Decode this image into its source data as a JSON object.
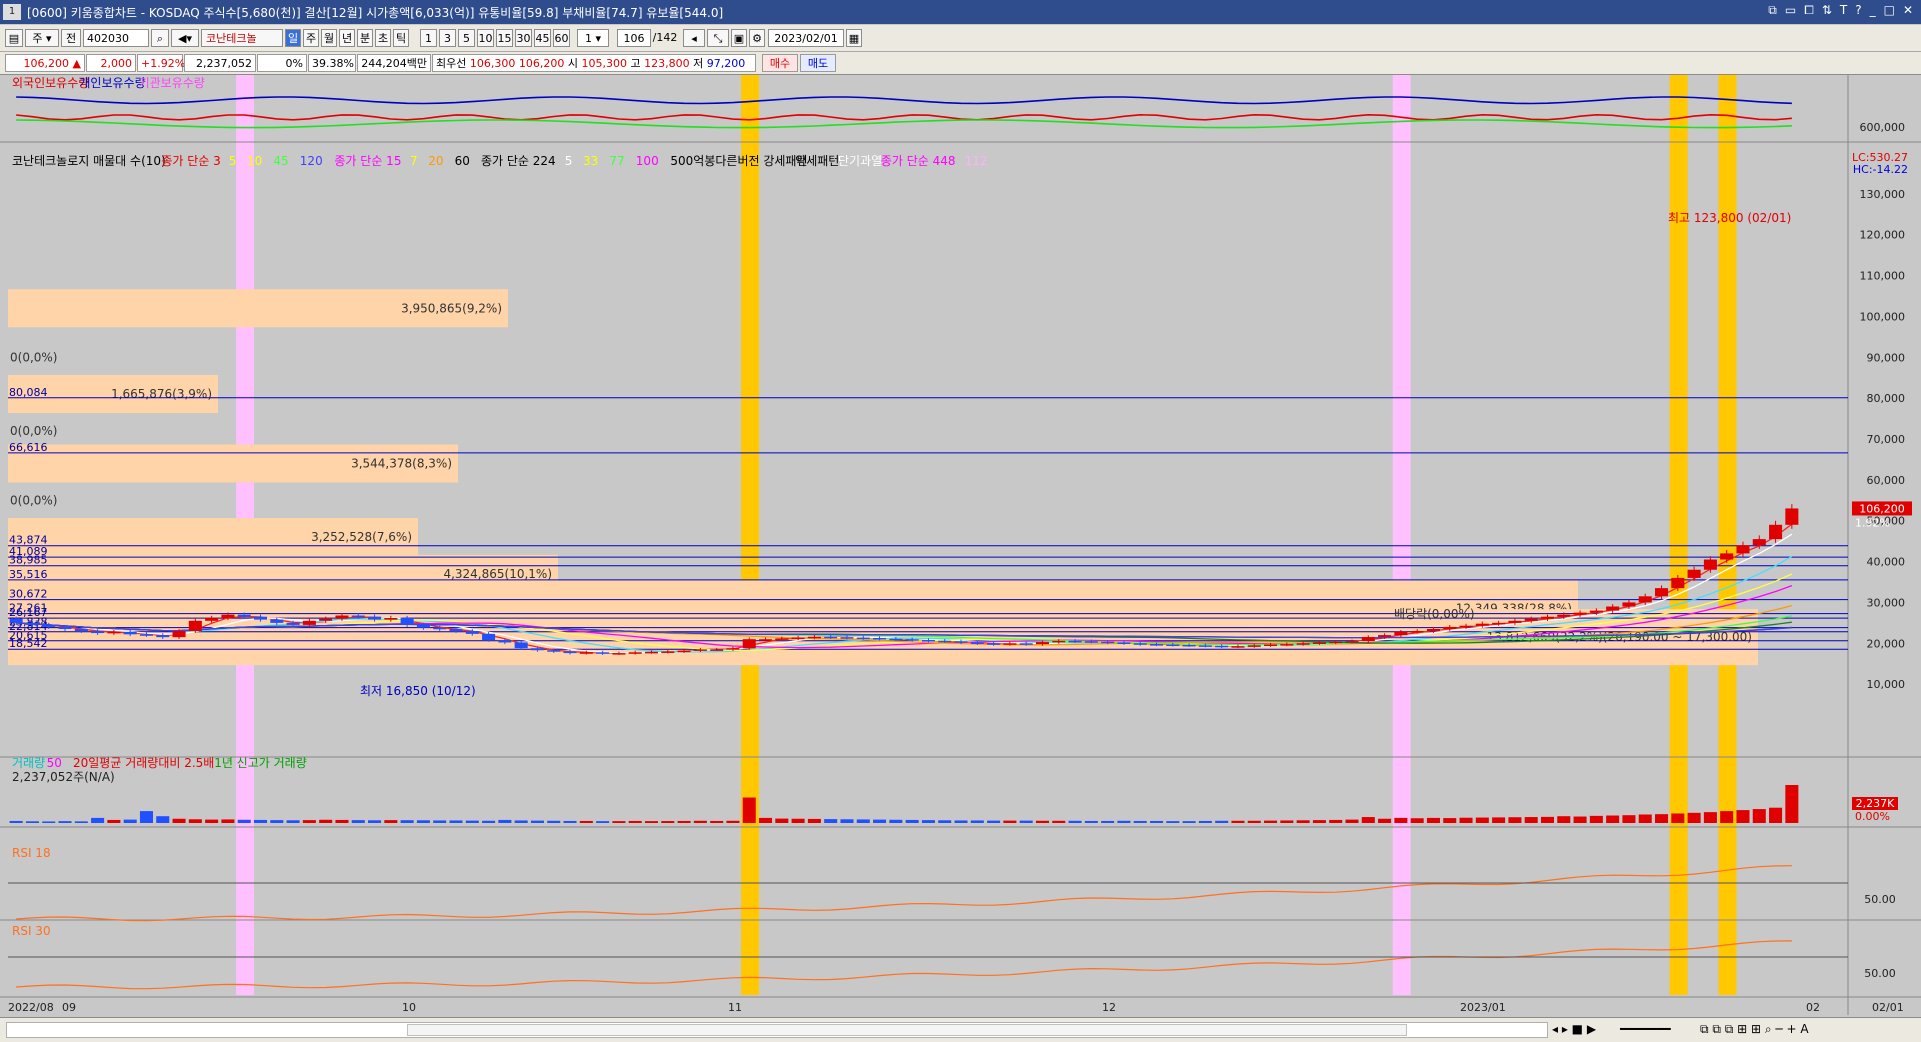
{
  "window": {
    "title": "[0600] 키움종합차트 - KOSDAQ 주식수[5,680(천)] 결산[12월] 시가총액[6,033(억)] 유통비율[59.8] 부채비율[74.7] 유보율[544.0]",
    "number": "1"
  },
  "toolbar": {
    "type_sel": "주",
    "prefix": "전",
    "code": "402030",
    "name": "코난테크놀",
    "periods": [
      "일",
      "주",
      "월",
      "년",
      "분",
      "초",
      "틱"
    ],
    "minutes": [
      "1",
      "3",
      "5",
      "10",
      "15",
      "30",
      "45",
      "60"
    ],
    "count_sel": "1",
    "page": "106",
    "page_total": "/142",
    "date": "2023/02/01"
  },
  "info": {
    "price": "106,200",
    "change": "2,000",
    "change_pct": "+1.92%",
    "volume": "2,237,052",
    "ratio": "0%",
    "ratio2": "39.38%",
    "amount": "244,204백만",
    "best_label": "최우선",
    "best_ask": "106,300",
    "best_bid": "106,200",
    "open_label": "시",
    "open": "105,300",
    "high_label": "고",
    "high": "123,800",
    "low_label": "저",
    "low": "97,200",
    "buy_btn": "매수",
    "sell_btn": "매도"
  },
  "legend": {
    "top": [
      {
        "text": "외국인보유수량",
        "color": "#e00000"
      },
      {
        "text": "개인보유수량",
        "color": "#0000c0"
      },
      {
        "text": "기관보유수량",
        "color": "#ff40ff"
      }
    ],
    "price": [
      {
        "text": "코난테크놀로지 매물대 수(10)",
        "color": "#000000"
      },
      {
        "text": "종가 단순 3",
        "color": "#e00000"
      },
      {
        "text": "5",
        "color": "#ffff00"
      },
      {
        "text": "10",
        "color": "#ffff00"
      },
      {
        "text": "45",
        "color": "#40ff40"
      },
      {
        "text": "120",
        "color": "#4040ff"
      },
      {
        "text": "종가 단순 15",
        "color": "#ff00ff"
      },
      {
        "text": "7",
        "color": "#ffff00"
      },
      {
        "text": "20",
        "color": "#ff9900"
      },
      {
        "text": "60",
        "color": "#000000"
      },
      {
        "text": "종가 단순 224",
        "color": "#000000"
      },
      {
        "text": "5",
        "color": "#ffffff"
      },
      {
        "text": "33",
        "color": "#ffff00"
      },
      {
        "text": "77",
        "color": "#40ff40"
      },
      {
        "text": "100",
        "color": "#ff00ff"
      },
      {
        "text": "500억봉다른버전 강세패턴",
        "color": "#000000"
      },
      {
        "text": "약세패턴",
        "color": "#000000"
      },
      {
        "text": "단기과열",
        "color": "#ffffff"
      },
      {
        "text": "종가 단순 448",
        "color": "#ff00ff"
      },
      {
        "text": "112",
        "color": "#ffb0ff"
      }
    ],
    "volume": [
      {
        "text": "거래량",
        "color": "#00c0c0"
      },
      {
        "text": "50",
        "color": "#ff00ff"
      },
      {
        "text": "20일평균 거래량대비 2.5배",
        "color": "#e00000"
      },
      {
        "text": "1년 신고가 거래량",
        "color": "#00a000"
      }
    ],
    "volume_value": "2,237,052주(N/A)",
    "rsi18": "RSI 18",
    "rsi30": "RSI 30"
  },
  "chart_data": {
    "type": "candlestick",
    "dates": [
      "2022/08/22",
      "2022/08/23",
      "2022/08/24",
      "2022/08/25",
      "2022/08/26",
      "2022/08/29",
      "2022/08/30",
      "2022/08/31",
      "2022/09/01",
      "2022/09/02",
      "2022/09/05",
      "2022/09/06",
      "2022/09/07",
      "2022/09/08",
      "2022/09/13",
      "2022/09/14",
      "2022/09/15",
      "2022/09/16",
      "2022/09/19",
      "2022/09/20",
      "2022/09/21",
      "2022/09/22",
      "2022/09/23",
      "2022/09/26",
      "2022/09/27",
      "2022/09/28",
      "2022/09/29",
      "2022/09/30",
      "2022/10/04",
      "2022/10/05",
      "2022/10/06",
      "2022/10/07",
      "2022/10/11",
      "2022/10/12",
      "2022/10/13",
      "2022/10/14",
      "2022/10/17",
      "2022/10/18",
      "2022/10/19",
      "2022/10/20",
      "2022/10/21",
      "2022/10/24",
      "2022/10/25",
      "2022/10/26",
      "2022/10/27",
      "2022/10/28",
      "2022/10/31",
      "2022/11/01",
      "2022/11/02",
      "2022/11/03",
      "2022/11/04",
      "2022/11/07",
      "2022/11/08",
      "2022/11/09",
      "2022/11/10",
      "2022/11/11",
      "2022/11/14",
      "2022/11/15",
      "2022/11/16",
      "2022/11/17",
      "2022/11/18",
      "2022/11/21",
      "2022/11/22",
      "2022/11/23",
      "2022/11/24",
      "2022/11/25",
      "2022/11/28",
      "2022/11/29",
      "2022/11/30",
      "2022/12/01",
      "2022/12/02",
      "2022/12/05",
      "2022/12/06",
      "2022/12/07",
      "2022/12/08",
      "2022/12/09",
      "2022/12/12",
      "2022/12/13",
      "2022/12/14",
      "2022/12/15",
      "2022/12/16",
      "2022/12/19",
      "2022/12/20",
      "2022/12/21",
      "2022/12/22",
      "2022/12/23",
      "2022/12/26",
      "2022/12/27",
      "2022/12/28",
      "2023/01/02",
      "2023/01/03",
      "2023/01/04",
      "2023/01/05",
      "2023/01/06",
      "2023/01/09",
      "2023/01/10",
      "2023/01/11",
      "2023/01/12",
      "2023/01/13",
      "2023/01/16",
      "2023/01/17",
      "2023/01/18",
      "2023/01/19",
      "2023/01/20",
      "2023/01/25",
      "2023/01/26",
      "2023/01/27",
      "2023/01/30",
      "2023/01/31",
      "2023/02/01"
    ],
    "open": [
      26000,
      25000,
      24500,
      24000,
      23500,
      23000,
      22500,
      22800,
      22200,
      22000,
      21500,
      23000,
      25500,
      26200,
      27000,
      26500,
      25800,
      25000,
      24500,
      25500,
      26000,
      26800,
      26500,
      25800,
      26200,
      24500,
      23800,
      23500,
      23000,
      22300,
      20800,
      20200,
      18800,
      18300,
      18000,
      17600,
      17800,
      17500,
      17600,
      17800,
      17900,
      18000,
      18200,
      18500,
      18500,
      18800,
      21000,
      21000,
      21200,
      21400,
      21600,
      21500,
      21400,
      21300,
      21100,
      21000,
      20800,
      20600,
      20500,
      20200,
      20000,
      19800,
      20000,
      19800,
      20300,
      20600,
      20500,
      20400,
      20200,
      20000,
      19800,
      19700,
      19600,
      19500,
      19400,
      19200,
      19300,
      19500,
      19700,
      19800,
      20000,
      20200,
      20400,
      20500,
      21500,
      22000,
      22800,
      23000,
      23500,
      24000,
      24300,
      24800,
      25000,
      25500,
      26000,
      26500,
      27000,
      27500,
      28000,
      29000,
      30000,
      31500,
      33500,
      36000,
      38000,
      40500,
      42000,
      44000,
      45500,
      49000
    ],
    "close": [
      25000,
      24500,
      24000,
      23500,
      23000,
      22500,
      22800,
      22200,
      22000,
      21500,
      23000,
      25500,
      26200,
      27000,
      26500,
      25800,
      25000,
      24500,
      25500,
      26000,
      26800,
      26500,
      25800,
      26200,
      24500,
      23800,
      23500,
      23000,
      22300,
      20800,
      20200,
      18800,
      18300,
      18000,
      17600,
      17800,
      17500,
      17600,
      17800,
      17900,
      18000,
      18200,
      18500,
      18500,
      18800,
      21000,
      21000,
      21200,
      21400,
      21600,
      21500,
      21400,
      21300,
      21100,
      21000,
      20800,
      20600,
      20500,
      20200,
      20000,
      19800,
      20000,
      19800,
      20300,
      20600,
      20500,
      20400,
      20200,
      20000,
      19800,
      19700,
      19600,
      19500,
      19400,
      19200,
      19300,
      19500,
      19700,
      19800,
      20000,
      20200,
      20400,
      20500,
      21500,
      22000,
      22800,
      23000,
      23500,
      24000,
      24300,
      24800,
      25000,
      25500,
      26000,
      26500,
      27000,
      27500,
      28000,
      29000,
      30000,
      31500,
      33500,
      36000,
      38000,
      40500,
      42000,
      44000,
      45500,
      49000,
      53000
    ],
    "volume": [
      120,
      100,
      90,
      110,
      95,
      300,
      180,
      200,
      700,
      400,
      250,
      220,
      200,
      210,
      190,
      180,
      170,
      160,
      170,
      190,
      180,
      170,
      160,
      170,
      165,
      160,
      150,
      150,
      140,
      130,
      180,
      150,
      140,
      130,
      120,
      120,
      110,
      110,
      120,
      110,
      115,
      120,
      130,
      120,
      130,
      1500,
      300,
      260,
      250,
      240,
      230,
      220,
      210,
      200,
      190,
      180,
      170,
      160,
      150,
      150,
      140,
      140,
      140,
      130,
      130,
      130,
      120,
      120,
      130,
      120,
      120,
      110,
      110,
      120,
      130,
      130,
      130,
      140,
      150,
      160,
      170,
      180,
      200,
      350,
      250,
      300,
      280,
      300,
      290,
      310,
      320,
      330,
      340,
      350,
      360,
      400,
      380,
      420,
      440,
      460,
      500,
      520,
      560,
      600,
      640,
      700,
      760,
      820,
      900,
      2237
    ],
    "ylim": [
      0,
      140000
    ],
    "price_axis_labels": [
      "130,000",
      "120,000",
      "110,000",
      "100,000",
      "90,000",
      "80,000",
      "70,000",
      "60,000",
      "50,000",
      "40,000",
      "30,000",
      "20,000",
      "10,000"
    ],
    "x_axis_labels": [
      "2022/08",
      "09",
      "10",
      "11",
      "12",
      "2023/01",
      "02",
      "02/01"
    ],
    "current_price_label": "106,200",
    "current_pct_label": "1.92%",
    "top_axis_label": "600,000",
    "lc_label": "LC:530.27",
    "hc_label": "HC:-14.22",
    "volume_axis_label": "2,237K",
    "volume_pct_label": "0.00%",
    "rsi18_axis_label": "50.00",
    "rsi30_axis_label": "50.00",
    "high_annotation": "최고 123,800 (02/01)",
    "low_annotation": "최저 16,850 (10/12)",
    "dividend_annotation": "배당락(0,00%)",
    "volume_profile": [
      {
        "label": "3,950,865(9,2%)",
        "price": 102000
      },
      {
        "label": "1,665,876(3,9%)",
        "price": 81000
      },
      {
        "label": "3,544,378(8,3%)",
        "price": 64000
      },
      {
        "label": "3,252,528(7,6%)",
        "price": 46000
      },
      {
        "label": "4,324,865(10,1%)",
        "price": 37000
      },
      {
        "label": "12,349,338(28,8%)",
        "price": 28500
      },
      {
        "label": "13,812,669(32,2%)(26,190.00 ~ 17,300.00)",
        "price": 21500
      }
    ],
    "zero_labels": [
      {
        "label": "0(0,0%)",
        "price": 90000
      },
      {
        "label": "0(0,0%)",
        "price": 72000
      },
      {
        "label": "0(0,0%)",
        "price": 55000
      }
    ],
    "h_levels": [
      {
        "label": "80,084",
        "price": 80084
      },
      {
        "label": "66,616",
        "price": 66616
      },
      {
        "label": "43,874",
        "price": 43874
      },
      {
        "label": "41,089",
        "price": 41089
      },
      {
        "label": "38,985",
        "price": 38985
      },
      {
        "label": "35,516",
        "price": 35516
      },
      {
        "label": "30,672",
        "price": 30672
      },
      {
        "label": "27,261",
        "price": 27261
      },
      {
        "label": "26,167",
        "price": 26167
      },
      {
        "label": "23,838",
        "price": 23838
      },
      {
        "label": "22,814",
        "price": 22814
      },
      {
        "label": "20,615",
        "price": 20615
      },
      {
        "label": "18,542",
        "price": 18542
      }
    ]
  }
}
